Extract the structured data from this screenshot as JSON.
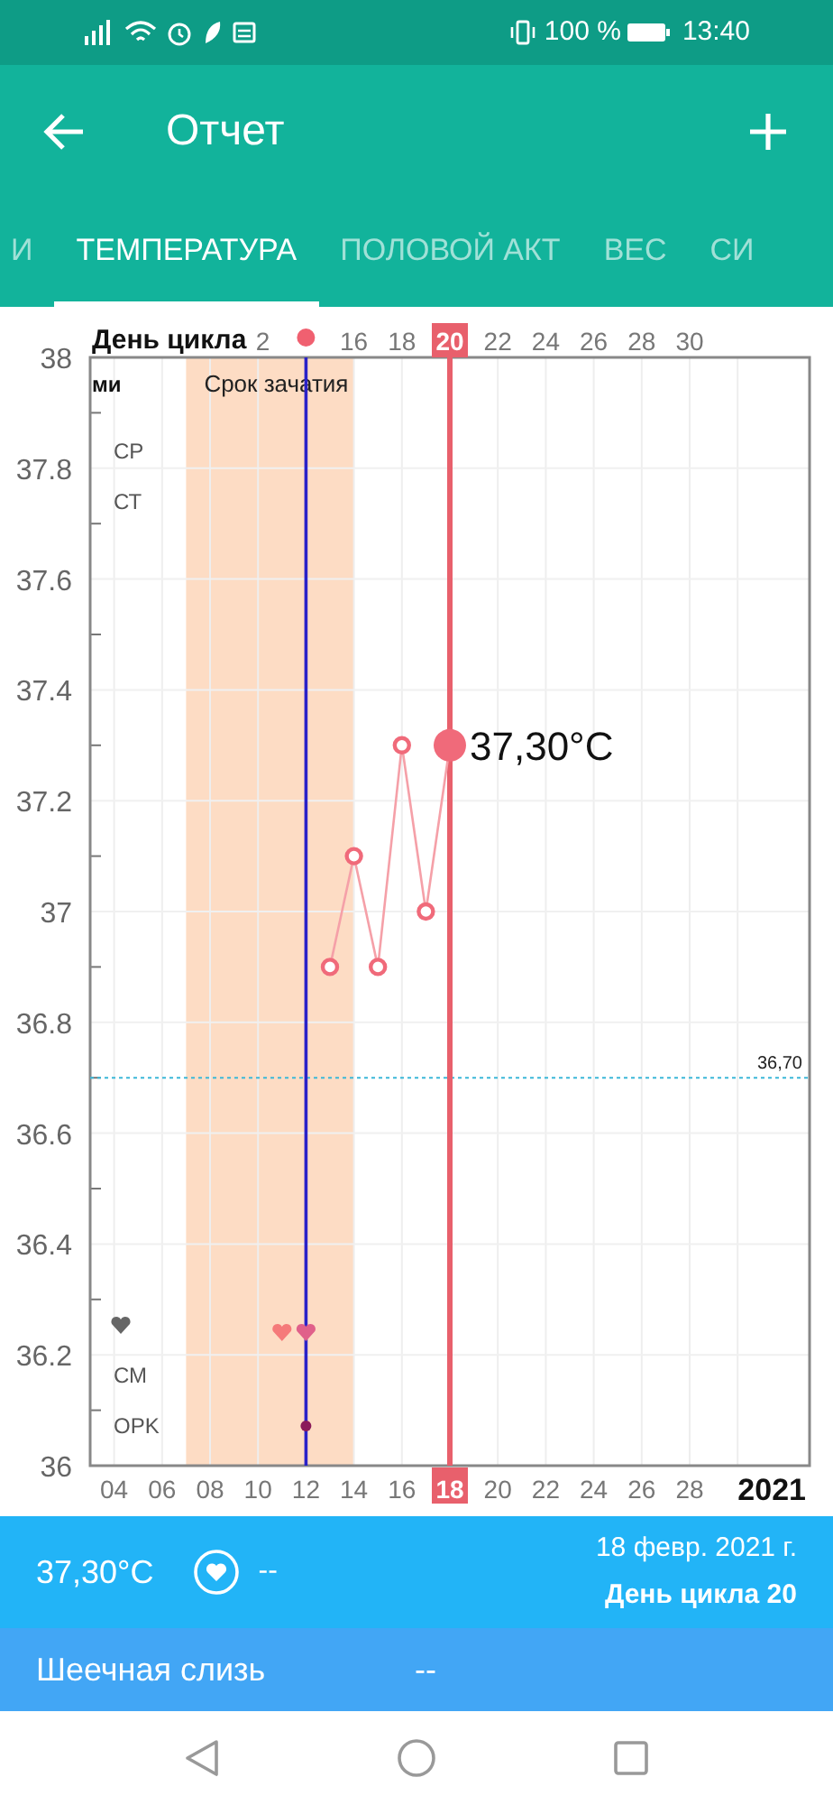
{
  "status_bar": {
    "battery": "100 %",
    "time": "13:40"
  },
  "app_bar": {
    "title": "Отчет"
  },
  "tabs": [
    {
      "label": "И",
      "selected": false
    },
    {
      "label": "ТЕМПЕРАТУРА",
      "selected": true
    },
    {
      "label": "ПОЛОВОЙ АКТ",
      "selected": false
    },
    {
      "label": "ВЕС",
      "selected": false
    },
    {
      "label": "СИ",
      "selected": false
    }
  ],
  "chart": {
    "top_axis": {
      "title": "День цикла",
      "ticks": [
        "2",
        "16",
        "18",
        "20",
        "22",
        "24",
        "26",
        "28",
        "30"
      ],
      "ovulation_marker": true
    },
    "row_labels": [
      {
        "label": "ми",
        "kind": "text"
      },
      {
        "label": "СР",
        "kind": "text"
      },
      {
        "label": "СТ",
        "kind": "text"
      },
      {
        "kind": "heart"
      },
      {
        "label": "СМ",
        "kind": "text"
      },
      {
        "label": "OPK",
        "kind": "text"
      }
    ],
    "markers": [
      {
        "kind": "heart",
        "color": "#f57a7a"
      },
      {
        "kind": "heart",
        "color": "#e0608a"
      },
      {
        "kind": "dot",
        "color": "#8b1a5a"
      }
    ],
    "year": "2021",
    "chart_data": {
      "type": "line",
      "x": [
        13,
        14,
        15,
        16,
        17,
        18
      ],
      "series": [
        {
          "color": "#f06a7a",
          "marker": "o",
          "values": [
            36.9,
            37.1,
            36.9,
            37.3,
            37.0,
            37.3
          ]
        }
      ],
      "ylim": [
        36,
        38
      ],
      "xlim": [
        3,
        33
      ],
      "grid": true,
      "yticks": [
        {
          "value": 38,
          "label": "38"
        },
        {
          "value": 37.8,
          "label": "37.8"
        },
        {
          "value": 37.6,
          "label": "37.6"
        },
        {
          "value": 37.4,
          "label": "37.4"
        },
        {
          "value": 37.2,
          "label": "37.2"
        },
        {
          "value": 37,
          "label": "37"
        },
        {
          "value": 36.8,
          "label": "36.8"
        },
        {
          "value": 36.6,
          "label": "36.6"
        },
        {
          "value": 36.4,
          "label": "36.4"
        },
        {
          "value": 36.2,
          "label": "36.2"
        },
        {
          "value": 36,
          "label": "36"
        }
      ],
      "xticks": [
        {
          "value": 4,
          "label": "04"
        },
        {
          "value": 6,
          "label": "06"
        },
        {
          "value": 8,
          "label": "08"
        },
        {
          "value": 10,
          "label": "10"
        },
        {
          "value": 12,
          "label": "12"
        },
        {
          "value": 14,
          "label": "14"
        },
        {
          "value": 16,
          "label": "16"
        },
        {
          "value": 18,
          "label": "18"
        },
        {
          "value": 20,
          "label": "20"
        },
        {
          "value": 22,
          "label": "22"
        },
        {
          "value": 24,
          "label": "24"
        },
        {
          "value": 26,
          "label": "26"
        },
        {
          "value": 28,
          "label": "28"
        }
      ],
      "bands": [
        {
          "axis": "x",
          "from": 7,
          "to": 14,
          "label": "Срок зачатия",
          "color": "#fddcc4"
        }
      ],
      "ref_lines": [
        {
          "axis": "y",
          "value": 36.7,
          "label": "36,70",
          "color": "#3cb8d8"
        },
        {
          "axis": "x",
          "value": 12,
          "color": "#2a22c8"
        },
        {
          "axis": "x",
          "value": 18,
          "color": "#e8606c"
        }
      ],
      "annotations": [
        {
          "text": "37,30°C",
          "x": 18,
          "y": 37.3
        }
      ]
    }
  },
  "summary": {
    "temperature": "37,30°C",
    "intercourse": "--",
    "date": "18 февр. 2021 г.",
    "cycle_day": "День цикла 20"
  },
  "details": [
    {
      "label": "Шеечная слизь",
      "value": "--"
    }
  ]
}
